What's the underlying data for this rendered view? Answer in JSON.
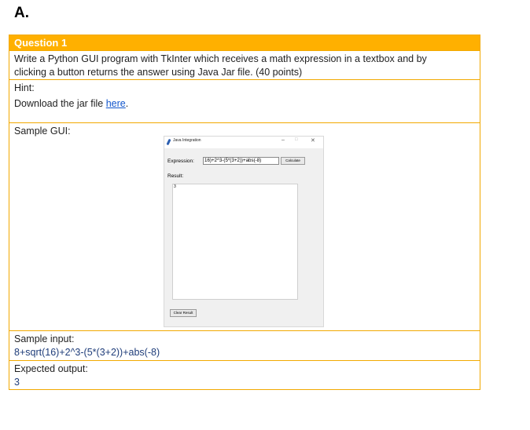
{
  "section_title": "A.",
  "question": {
    "header": "Question 1",
    "description_line1": "Write a Python GUI program with TkInter which receives a math expression in a textbox and by",
    "description_line2": "clicking a button returns the answer using Java Jar file. (40 points)",
    "hint_label": "Hint:",
    "hint_text": "Download the jar file ",
    "hint_link": "here",
    "hint_period": ".",
    "sample_gui_label": "Sample GUI:",
    "sample_input_label": "Sample input:",
    "sample_input_value": "8+sqrt(16)+2^3-(5*(3+2))+abs(-8)",
    "expected_output_label": "Expected output:",
    "expected_output_value": "3"
  },
  "tk_window": {
    "title": "Java Integration",
    "minimize": "–",
    "maximize": "□",
    "close": "✕",
    "expression_label": "Expression:",
    "expression_value": "16)+2^3-(5*(3+2))+abs(-8)",
    "calculate_button": "Calculate",
    "result_label": "Result:",
    "result_value": "3",
    "clear_button": "Clear Result"
  },
  "colors": {
    "header_bg": "#ffb000",
    "border": "#f2a900",
    "link": "#1155cc"
  }
}
